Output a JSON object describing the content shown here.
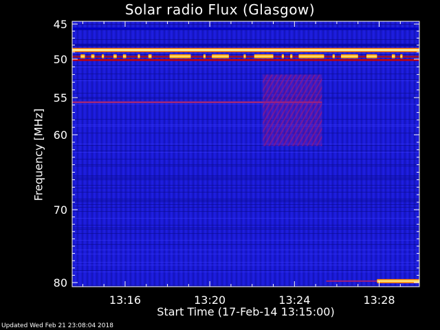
{
  "chart_data": {
    "type": "heatmap",
    "title": "Solar radio Flux (Glasgow)",
    "xlabel": "Start Time (17-Feb-14 13:15:00)",
    "ylabel": "Frequency [MHz]",
    "x_range_minutes": [
      13.5,
      29.9
    ],
    "x_ticks": [
      {
        "t": 16,
        "label": "13:16"
      },
      {
        "t": 20,
        "label": "13:20"
      },
      {
        "t": 24,
        "label": "13:24"
      },
      {
        "t": 28,
        "label": "13:28"
      }
    ],
    "y_range_mhz": [
      44.5,
      80.5
    ],
    "y_ticks": [
      {
        "mhz": 45,
        "label": "45"
      },
      {
        "mhz": 50,
        "label": "50"
      },
      {
        "mhz": 55,
        "label": "55"
      },
      {
        "mhz": 60,
        "label": "60"
      },
      {
        "mhz": 70,
        "label": "70"
      },
      {
        "mhz": 80,
        "label": "80"
      }
    ],
    "background_color": "#1a1ad6",
    "features": [
      {
        "name": "continuous emission band",
        "mhz": 48.7,
        "t_start": 13.5,
        "t_end": 29.9,
        "color": "#ffb000"
      },
      {
        "name": "intermittent emission",
        "mhz": 49.6,
        "t_start": 13.5,
        "t_end": 29.9,
        "color": "#ff9000"
      },
      {
        "name": "narrowband line",
        "mhz": 50.1,
        "t_start": 13.5,
        "t_end": 29.9,
        "color": "#c80000"
      },
      {
        "name": "narrowband line",
        "mhz": 55.6,
        "t_start": 13.5,
        "t_end": 25.3,
        "color": "#a0287a"
      },
      {
        "name": "broadband enhancement",
        "mhz_range": [
          52,
          61.5
        ],
        "t_start": 22.5,
        "t_end": 25.3,
        "color": "#7a1aa0"
      },
      {
        "name": "late emission",
        "mhz": 79.8,
        "t_start": 27.9,
        "t_end": 29.9,
        "color": "#ffb000"
      }
    ],
    "grid": false
  },
  "footer": "Updated Wed Feb 21 23:08:04 2018"
}
